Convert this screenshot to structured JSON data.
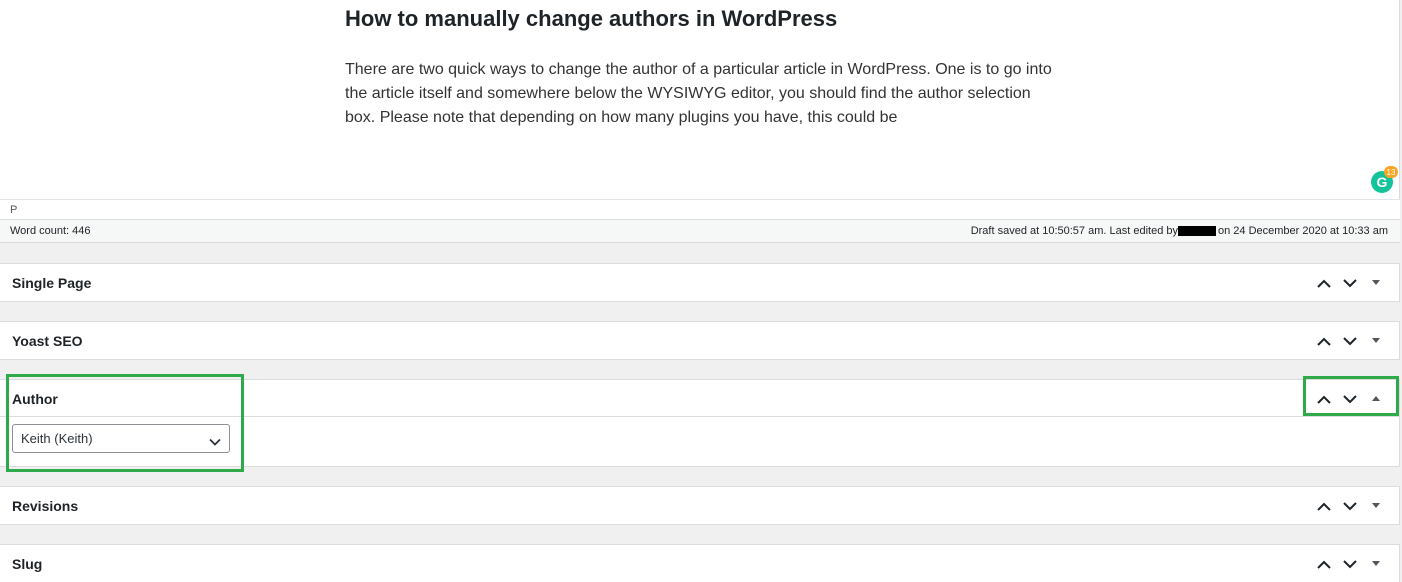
{
  "editor": {
    "heading": "How to manually change authors in WordPress",
    "paragraph": "There are two quick ways to change the author of a particular article in WordPress. One is to go into the article itself and somewhere below the WYSIWYG editor, you should find the author selection box. Please note that depending on how many plugins you have, this could be",
    "path": "P",
    "grammarly_icon": "G",
    "grammarly_count": "13"
  },
  "status_bar": {
    "word_count": "Word count: 446",
    "draft_prefix": "Draft saved at 10:50:57 am. Last edited by",
    "draft_suffix": "on 24 December 2020 at 10:33 am"
  },
  "metaboxes": {
    "single_page": {
      "title": "Single Page"
    },
    "yoast_seo": {
      "title": "Yoast SEO"
    },
    "author": {
      "title": "Author",
      "selected": "Keith (Keith)"
    },
    "revisions": {
      "title": "Revisions"
    },
    "slug": {
      "title": "Slug"
    }
  },
  "icons": {
    "move_up": "chevron-up-icon",
    "move_down": "chevron-down-icon",
    "toggle": "triangle-toggle-icon"
  },
  "colors": {
    "highlight": "#2eaa4a",
    "grammarly": "#15c39a",
    "grammarly_badge": "#f5a623"
  }
}
